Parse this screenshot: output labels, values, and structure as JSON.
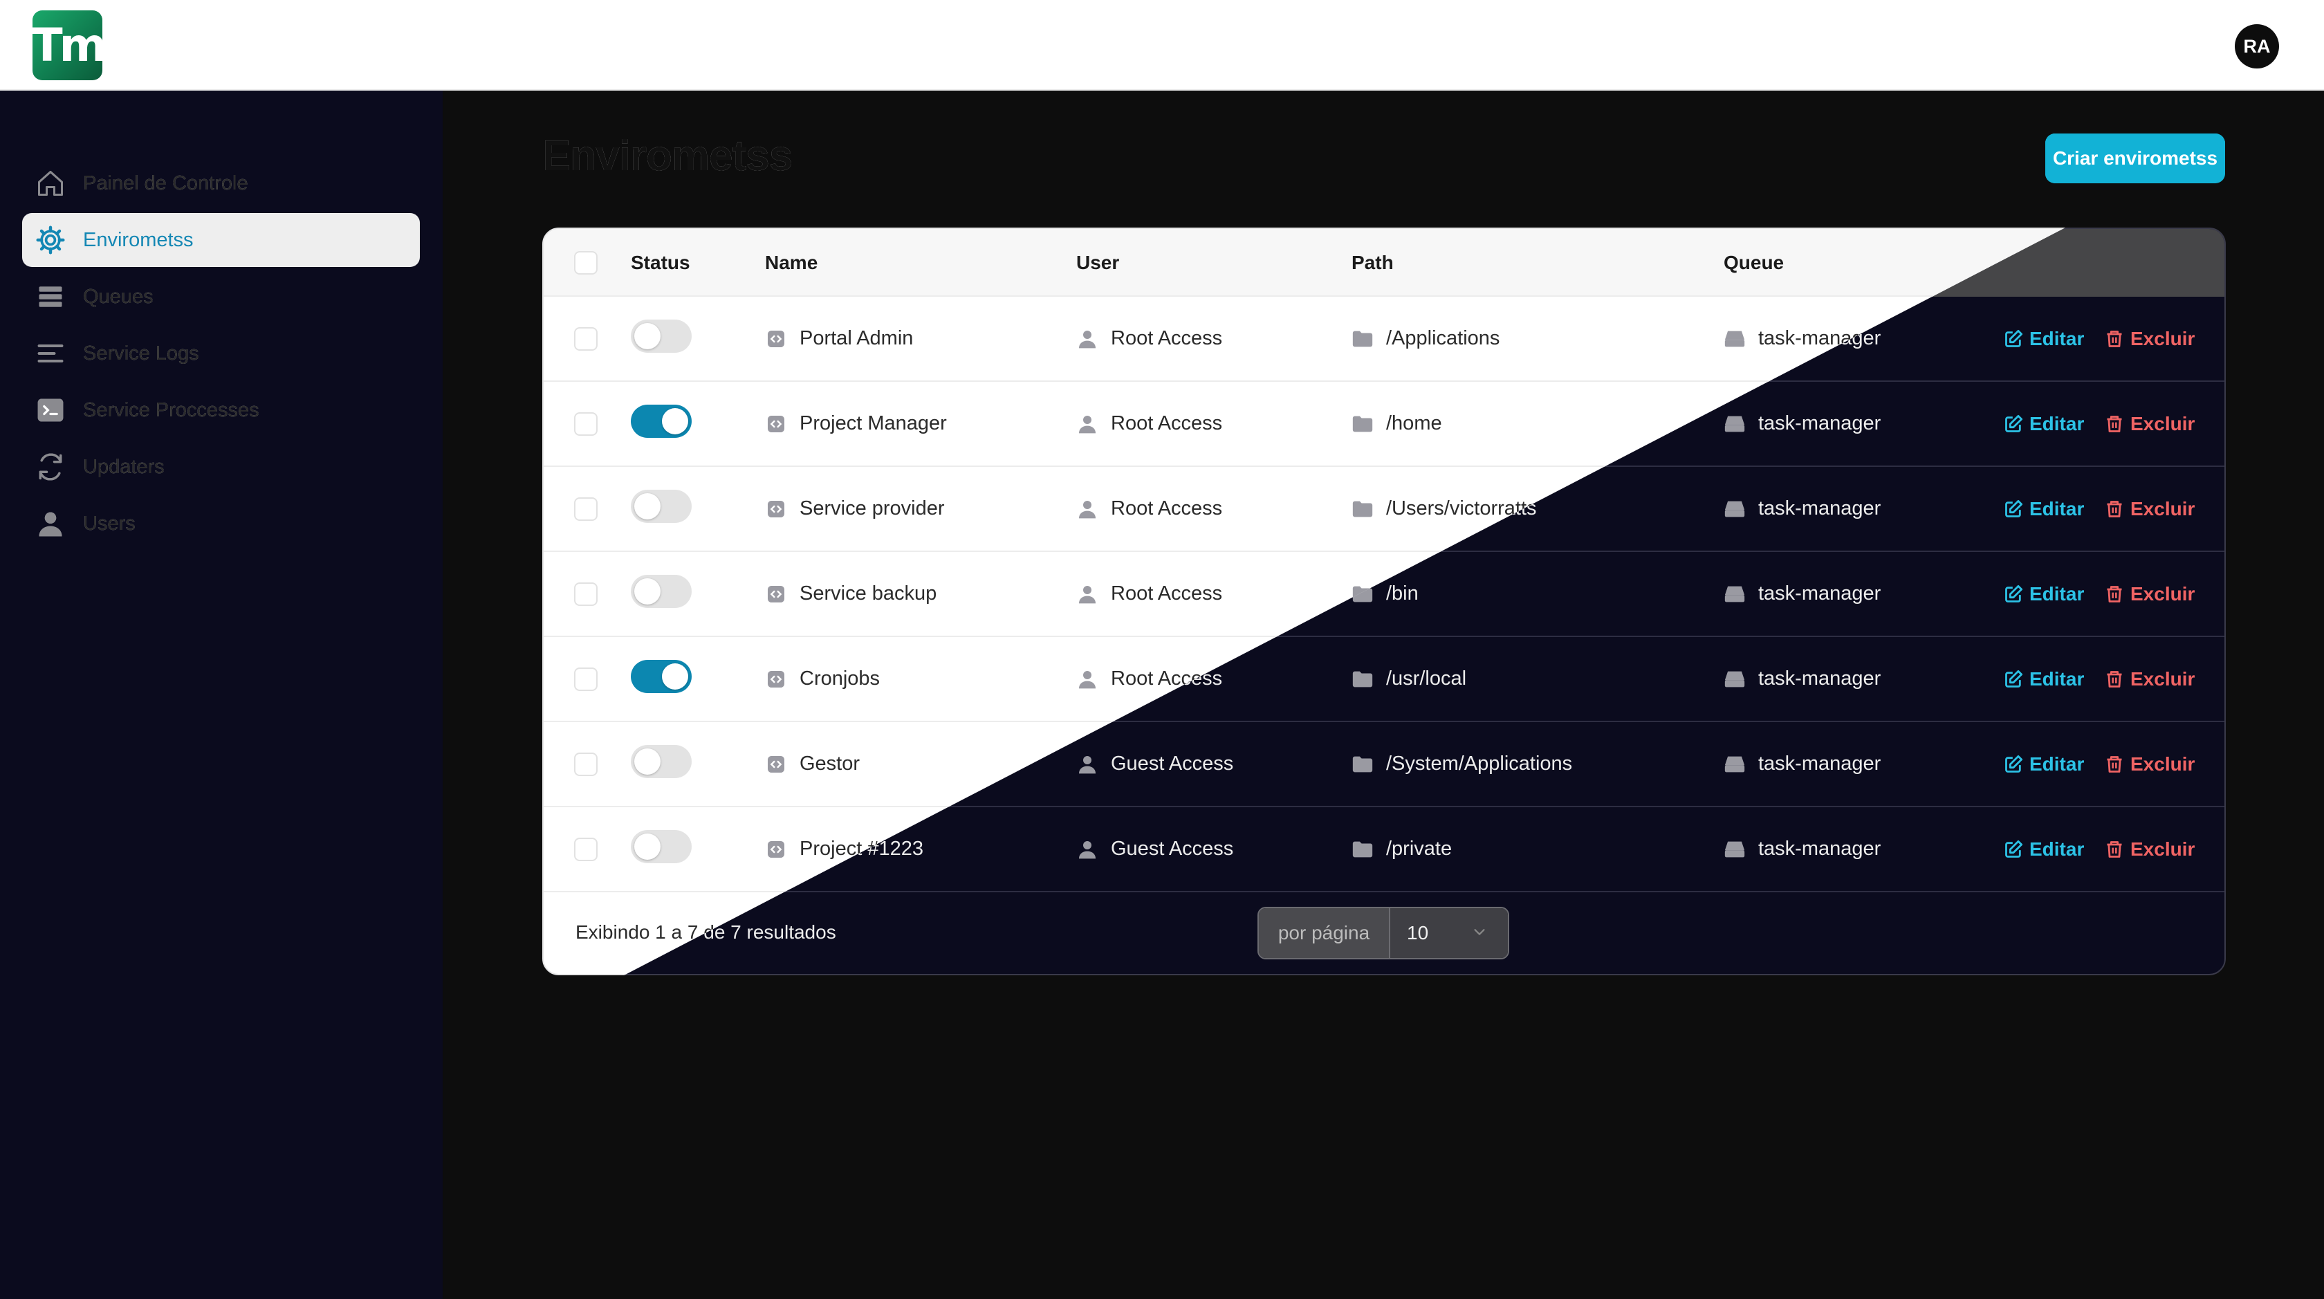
{
  "app": {
    "logo_text": "Tm",
    "user_initials": "RA"
  },
  "sidebar": {
    "items": [
      {
        "label": "Painel de Controle",
        "icon": "home-icon",
        "active": false
      },
      {
        "label": "Envirometss",
        "icon": "gear-icon",
        "active": true
      },
      {
        "label": "Queues",
        "icon": "stack-icon",
        "active": false
      },
      {
        "label": "Service Logs",
        "icon": "lines-icon",
        "active": false
      },
      {
        "label": "Service Proccesses",
        "icon": "terminal-icon",
        "active": false
      },
      {
        "label": "Updaters",
        "icon": "refresh-icon",
        "active": false
      },
      {
        "label": "Users",
        "icon": "user-icon",
        "active": false
      }
    ]
  },
  "main": {
    "title": "Envirometss",
    "create_button": "Criar envirometss"
  },
  "table": {
    "columns": [
      "Status",
      "Name",
      "User",
      "Path",
      "Queue"
    ],
    "actions": {
      "edit": "Editar",
      "delete": "Excluir"
    },
    "rows": [
      {
        "active": false,
        "name": "Portal Admin",
        "user": "Root Access",
        "path": "/Applications",
        "queue": "task-manager"
      },
      {
        "active": true,
        "name": "Project Manager",
        "user": "Root Access",
        "path": "/home",
        "queue": "task-manager"
      },
      {
        "active": false,
        "name": "Service provider",
        "user": "Root Access",
        "path": "/Users/victorratts",
        "queue": "task-manager"
      },
      {
        "active": false,
        "name": "Service backup",
        "user": "Root Access",
        "path": "/bin",
        "queue": "task-manager"
      },
      {
        "active": true,
        "name": "Cronjobs",
        "user": "Root Access",
        "path": "/usr/local",
        "queue": "task-manager"
      },
      {
        "active": false,
        "name": "Gestor",
        "user": "Guest Access",
        "path": "/System/Applications",
        "queue": "task-manager"
      },
      {
        "active": false,
        "name": "Project #1223",
        "user": "Guest Access",
        "path": "/private",
        "queue": "task-manager"
      }
    ],
    "footer": {
      "summary": "Exibindo 1 a 7 de 7 resultados",
      "per_page_label": "por página",
      "per_page_value": "10"
    }
  },
  "colors": {
    "accent": "#12b2d6",
    "toggle_on": "#0c87b0",
    "danger": "#ec4b4b",
    "dark_bg": "#0b0b1e"
  }
}
